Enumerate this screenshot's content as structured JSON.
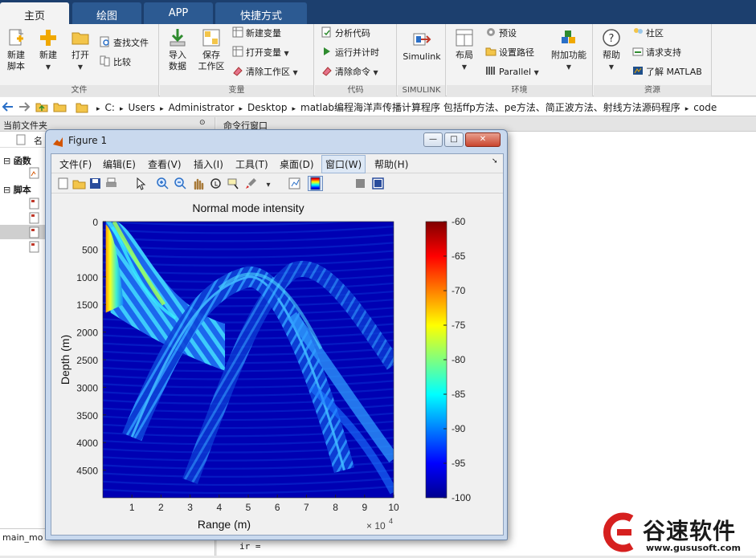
{
  "tabs": [
    {
      "label": "主页"
    },
    {
      "label": "绘图"
    },
    {
      "label": "APP"
    },
    {
      "label": "快捷方式"
    }
  ],
  "ribbon": {
    "file": {
      "group_label": "文件",
      "new_script": "新建\n脚本",
      "new": "新建",
      "open": "打开",
      "find_files": "查找文件",
      "compare": "比较"
    },
    "variable": {
      "group_label": "变量",
      "import": "导入\n数据",
      "save_ws": "保存\n工作区",
      "new_var": "新建变量",
      "open_var": "打开变量",
      "clear_ws": "清除工作区"
    },
    "code": {
      "group_label": "代码",
      "analyze": "分析代码",
      "run_time": "运行并计时",
      "clear_cmd": "清除命令"
    },
    "simulink": {
      "group_label": "SIMULINK",
      "label": "Simulink"
    },
    "env": {
      "group_label": "环境",
      "layout": "布局",
      "prefs": "预设",
      "set_path": "设置路径",
      "parallel": "Parallel",
      "addons": "附加功能"
    },
    "resources": {
      "group_label": "资源",
      "help": "帮助",
      "community": "社区",
      "support": "请求支持",
      "learn": "了解 MATLAB"
    }
  },
  "address": {
    "crumbs": [
      "C:",
      "Users",
      "Administrator",
      "Desktop",
      "matlab编程海洋声传播计算程序 包括ffp方法、pe方法、简正波方法、射线方法源码程序",
      "code"
    ]
  },
  "left_pane": {
    "title": "当前文件夹",
    "name_col": "名",
    "functions": "函数",
    "scripts": "脚本",
    "bottom_tab": "main_mo"
  },
  "command_window": {
    "title": "命令行窗口",
    "line": "ir ="
  },
  "figure": {
    "title": "Figure 1",
    "menu": [
      "文件(F)",
      "编辑(E)",
      "查看(V)",
      "插入(I)",
      "工具(T)",
      "桌面(D)",
      "窗口(W)",
      "帮助(H)"
    ],
    "buttons": {
      "minimize": "—",
      "restore": "□",
      "close": "✕"
    },
    "tool_icons": [
      "new-figure-icon",
      "open-icon",
      "save-icon",
      "print-icon",
      "pointer-icon",
      "zoom-in-icon",
      "zoom-out-icon",
      "pan-icon",
      "rotate-icon",
      "data-cursor-icon",
      "brush-icon",
      "link-icon",
      "colorbar-icon",
      "legend-icon",
      "hide-plot-tools-icon",
      "show-plot-tools-icon"
    ]
  },
  "chart_data": {
    "type": "heatmap",
    "title": "Normal mode intensity",
    "xlabel": "Range (m)",
    "ylabel": "Depth (m)",
    "x_exponent_label": "× 10",
    "x_exponent_power": "4",
    "x_ticks": [
      "1",
      "2",
      "3",
      "4",
      "5",
      "6",
      "7",
      "8",
      "9",
      "10"
    ],
    "x_tick_values": [
      1,
      2,
      3,
      4,
      5,
      6,
      7,
      8,
      9,
      10
    ],
    "xlim": [
      0.1,
      10
    ],
    "y_ticks": [
      "0",
      "500",
      "1000",
      "1500",
      "2000",
      "2500",
      "3000",
      "3500",
      "4000",
      "4500"
    ],
    "y_tick_values": [
      0,
      500,
      1000,
      1500,
      2000,
      2500,
      3000,
      3500,
      4000,
      4500
    ],
    "ylim": [
      0,
      5000
    ],
    "y_reversed": true,
    "colorbar_ticks": [
      "-60",
      "-65",
      "-70",
      "-75",
      "-80",
      "-85",
      "-90",
      "-95",
      "-100"
    ],
    "colorbar_tick_values": [
      -60,
      -65,
      -70,
      -75,
      -80,
      -85,
      -90,
      -95,
      -100
    ],
    "clim": [
      -100,
      -60
    ],
    "colormap": "jet",
    "background_value": -98,
    "source_depth": 1000,
    "features": [
      {
        "name": "near-source fan",
        "range": [
          0.1,
          1.0
        ],
        "depth": [
          100,
          1500
        ],
        "level_db": -68
      },
      {
        "name": "ray-path arc",
        "range": [
          1.0,
          5.0
        ],
        "depth": [
          1000,
          3900
        ],
        "level_db": -86
      },
      {
        "name": "ray-path arc",
        "range": [
          5.0,
          8.3
        ],
        "depth": [
          1000,
          4500
        ],
        "level_db": -86
      },
      {
        "name": "deep branch",
        "range": [
          6.5,
          10.0
        ],
        "depth": [
          1700,
          4300
        ],
        "level_db": -88
      }
    ]
  },
  "watermark": {
    "name": "谷速软件",
    "url": "www.gususoft.com",
    "color": "#d6201f"
  }
}
